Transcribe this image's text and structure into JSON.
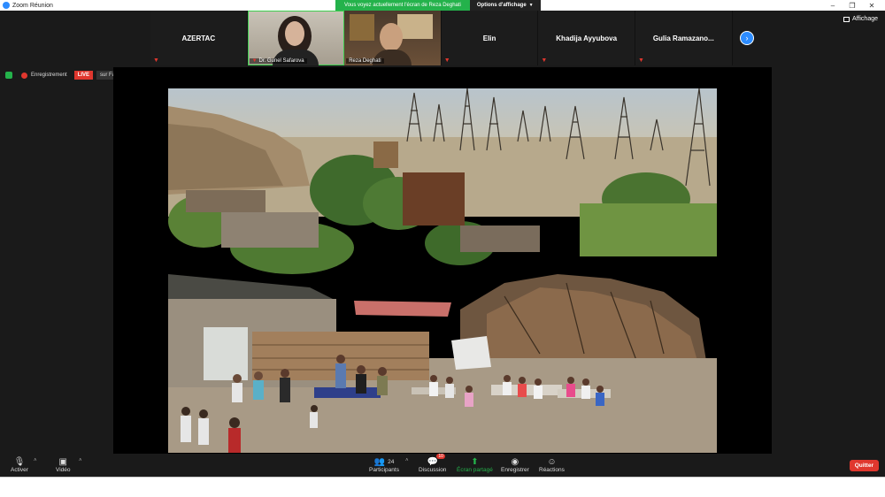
{
  "window": {
    "title": "Zoom Réunion"
  },
  "share_banner": {
    "text": "Vous voyez actuellement l'écran de Reza Deghati",
    "options_label": "Options d'affichage"
  },
  "participants": [
    {
      "name": "AZERTAC",
      "video": false
    },
    {
      "name": "Dr. Gunel Safarova",
      "video": true
    },
    {
      "name": "Reza Deghati",
      "video": true
    },
    {
      "name": "Elin",
      "video": false
    },
    {
      "name": "Khadija Ayyubova",
      "video": false
    },
    {
      "name": "Gulia  Ramazano...",
      "video": false
    }
  ],
  "view_label": "Affichage",
  "recording": {
    "label": "Enregistrement",
    "live": "LIVE",
    "platform": "sur Facebook"
  },
  "toolbar": {
    "mute_label": "Activer",
    "video_label": "Vidéo",
    "participants_label": "Participants",
    "participants_count": "24",
    "chat_label": "Discussion",
    "chat_badge": "10",
    "share_label": "Écran partagé",
    "record_label": "Enregistrer",
    "reactions_label": "Réactions",
    "quit_label": "Quitter"
  },
  "colors": {
    "accent": "#2d8cff",
    "share_green": "#24b24b",
    "danger": "#e0372e"
  }
}
